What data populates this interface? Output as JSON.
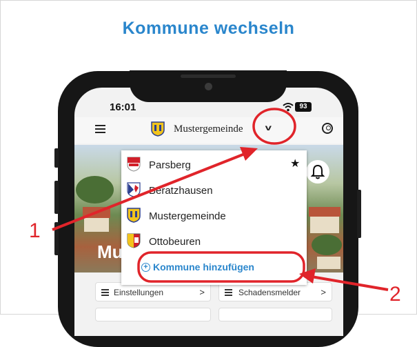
{
  "page_title": "Kommune wechseln",
  "status_bar": {
    "time": "16:01",
    "battery": "93"
  },
  "app_bar": {
    "current_commune": "Mustergemeinde"
  },
  "dropdown": {
    "items": [
      {
        "name": "Parsberg",
        "crest": "parsberg-crest",
        "favorite": true
      },
      {
        "name": "Beratzhausen",
        "crest": "beratzhausen-crest"
      },
      {
        "name": "Mustergemeinde",
        "crest": "mustergemeinde-crest"
      },
      {
        "name": "Ottobeuren",
        "crest": "ottobeuren-crest"
      }
    ],
    "add_label": "Kommune hinzufügen"
  },
  "hero_text": "Mu",
  "buttons": {
    "settings": "Einstellungen",
    "damage_report": "Schadensmelder"
  },
  "annotations": {
    "one": "1",
    "two": "2"
  },
  "colors": {
    "title_blue": "#2a86cc",
    "annotation_red": "#e0242a"
  },
  "icons": [
    "menu-icon",
    "user-icon",
    "bell-icon",
    "star-icon",
    "chevron-down-icon",
    "plus-circle-icon",
    "wifi-icon",
    "battery-icon"
  ]
}
